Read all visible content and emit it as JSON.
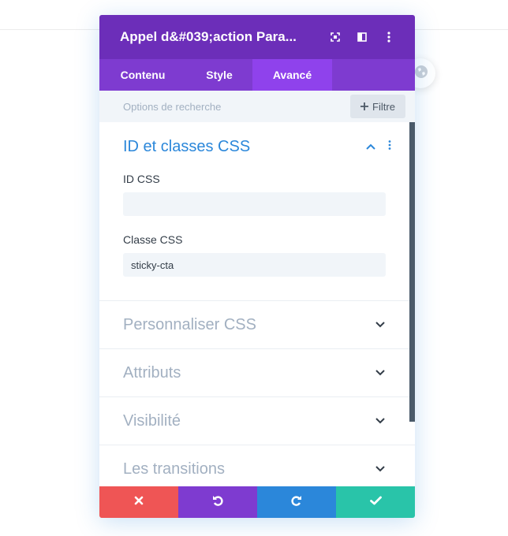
{
  "header": {
    "title": "Appel d&#039;action Para...",
    "icons": [
      "expand-icon",
      "split-view-icon",
      "more-vertical-icon"
    ]
  },
  "tabs": [
    {
      "label": "Contenu",
      "active": false
    },
    {
      "label": "Style",
      "active": false
    },
    {
      "label": "Avancé",
      "active": true
    }
  ],
  "search": {
    "placeholder": "Options de recherche",
    "filter_label": "Filtre"
  },
  "sections": {
    "open": {
      "title": "ID et classes CSS",
      "fields": [
        {
          "label": "ID CSS",
          "value": ""
        },
        {
          "label": "Classe CSS",
          "value": "sticky-cta"
        }
      ]
    },
    "collapsed": [
      {
        "title": "Personnaliser CSS"
      },
      {
        "title": "Attributs"
      },
      {
        "title": "Visibilité"
      },
      {
        "title": "Les transitions"
      }
    ]
  },
  "footer": {
    "buttons": [
      "cancel-icon",
      "undo-icon",
      "redo-icon",
      "check-icon"
    ]
  },
  "colors": {
    "header": "#6c2eb9",
    "tabs": "#7e3bd0",
    "active_tab": "#8f42ec",
    "accent_blue": "#2b87da",
    "cancel": "#ef5555",
    "save": "#29c4a9"
  }
}
